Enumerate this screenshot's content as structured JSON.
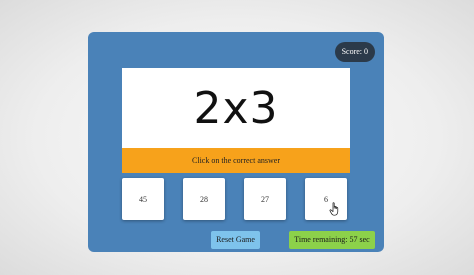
{
  "score": {
    "label": "Score: 0"
  },
  "question": {
    "text": "2x3"
  },
  "instruction": {
    "text": "Click on the correct answer"
  },
  "choices": [
    {
      "label": "45"
    },
    {
      "label": "28"
    },
    {
      "label": "27"
    },
    {
      "label": "6"
    }
  ],
  "controls": {
    "reset_label": "Reset Game",
    "timer_label": "Time remaining: 57 sec"
  },
  "colors": {
    "panel": "#4a82b8",
    "instruction_bar": "#f7a21b",
    "reset_button": "#7ec3ec",
    "timer_badge": "#8cd14a",
    "score_badge": "#2b3a4a"
  },
  "icons": {
    "pointer": "hand-pointer-icon"
  }
}
